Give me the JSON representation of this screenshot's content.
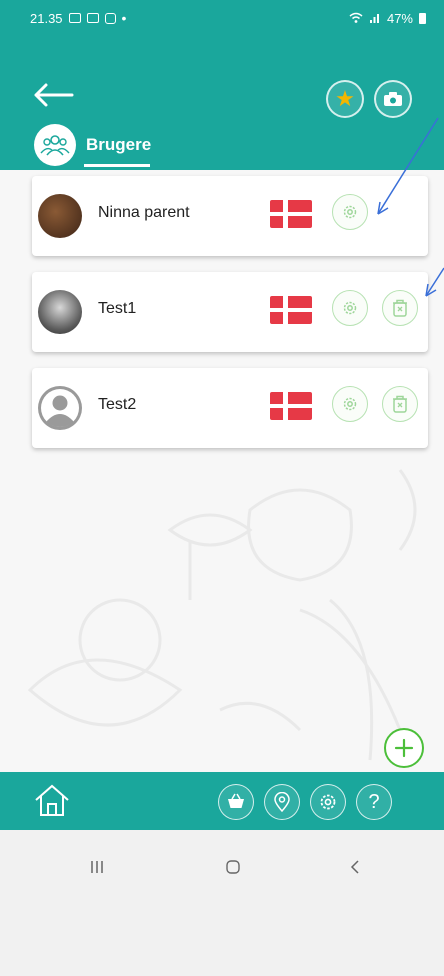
{
  "status_bar": {
    "time": "21.35",
    "battery": "47%",
    "left_icons": [
      "gallery-icon",
      "photo-icon",
      "instagram-icon"
    ],
    "right_icons": [
      "wifi-icon",
      "signal-icon",
      "battery-icon"
    ]
  },
  "header": {
    "back_icon": "arrow-left-icon",
    "favorites_icon": "star-icon",
    "camera_icon": "camera-icon",
    "tab_label": "Brugere",
    "tab_icon": "users-icon"
  },
  "users": [
    {
      "name": "Ninna parent",
      "avatar": "photo",
      "flag": "denmark-flag-icon",
      "has_delete": false
    },
    {
      "name": "Test1",
      "avatar": "photo",
      "flag": "denmark-flag-icon",
      "has_delete": true
    },
    {
      "name": "Test2",
      "avatar": "placeholder",
      "flag": "denmark-flag-icon",
      "has_delete": true
    }
  ],
  "fab_icon": "plus-icon",
  "bottom_nav": {
    "home_icon": "home-icon",
    "items": [
      "basket-icon",
      "location-pin-icon",
      "gear-icon",
      "?"
    ]
  },
  "system_nav": {
    "icons": [
      "recents-icon",
      "home-circle-icon",
      "back-chevron-icon"
    ]
  },
  "colors": {
    "teal": "#1aa79c",
    "flag_red": "#e63946",
    "green_accent": "#4cbf3a",
    "star": "#f2b600"
  }
}
